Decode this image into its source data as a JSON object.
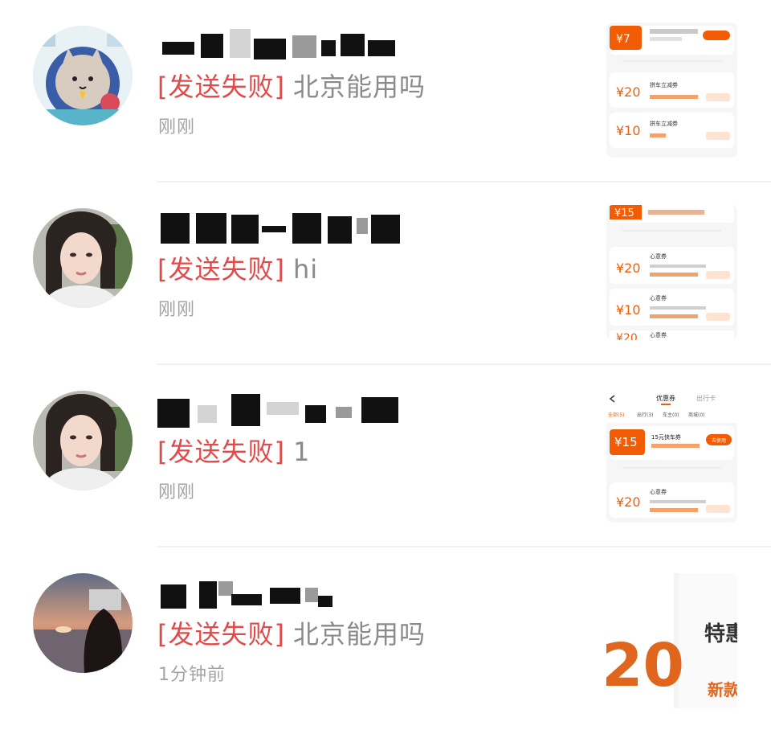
{
  "conversations": [
    {
      "avatar": "cat-cartoon-avatar",
      "status_label": "[发送失败]",
      "last_message": "北京能用吗",
      "time": "刚刚",
      "thumbnail": {
        "top_badge": "¥7",
        "amounts": [
          "¥20",
          "¥10"
        ],
        "items": [
          "拼车立减券",
          "拼车立减券"
        ]
      }
    },
    {
      "avatar": "woman-portrait-avatar",
      "status_label": "[发送失败]",
      "last_message": "hi",
      "time": "刚刚",
      "thumbnail": {
        "top_badge": "¥15",
        "amounts": [
          "¥20",
          "¥10",
          "¥20"
        ],
        "items": [
          "心意券",
          "心意券",
          "心意券"
        ]
      }
    },
    {
      "avatar": "woman-portrait-avatar",
      "status_label": "[发送失败]",
      "last_message": "1",
      "time": "刚刚",
      "thumbnail": {
        "tabs": [
          "优惠券",
          "出行卡"
        ],
        "filters": [
          "全部(5)",
          "出行(3)",
          "车主(0)",
          "商城(0)"
        ],
        "top_badge": "¥15",
        "coupon_title": "15元快车券",
        "button": "去使用",
        "amounts": [
          "¥20"
        ],
        "items": [
          "心意券"
        ]
      }
    },
    {
      "avatar": "sunset-beach-avatar",
      "status_label": "[发送失败]",
      "last_message": "北京能用吗",
      "time": "1分钟前",
      "thumbnail": {
        "big_number": "20",
        "side_text": "特惠",
        "side_text_2": "新款"
      }
    }
  ],
  "colors": {
    "fail_red": "#e04a4a",
    "message_gray": "#8a8a8a",
    "time_gray": "#a4a4a4",
    "coupon_orange": "#f25c05"
  }
}
